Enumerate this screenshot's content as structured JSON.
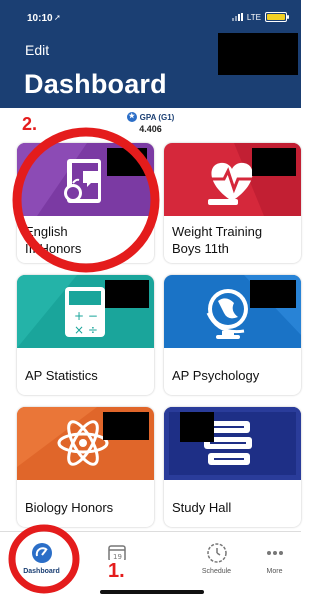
{
  "status_bar": {
    "time": "10:10",
    "carrier": "LTE"
  },
  "header": {
    "edit_label": "Edit",
    "title": "Dashboard"
  },
  "gpa": {
    "label": "GPA (G1)",
    "value": "4.406"
  },
  "annotations": {
    "step1": "1.",
    "step2": "2."
  },
  "cards": [
    {
      "label_line1": "English",
      "label_line2": "III Honors",
      "color": "#7b3aa3"
    },
    {
      "label_line1": "Weight Training",
      "label_line2": "Boys 11th",
      "color": "#d5283b"
    },
    {
      "label_line1": "AP Statistics",
      "label_line2": "",
      "color": "#1aa59b"
    },
    {
      "label_line1": "AP Psychology",
      "label_line2": "",
      "color": "#1a73c6"
    },
    {
      "label_line1": "Biology Honors",
      "label_line2": "",
      "color": "#e0662a"
    },
    {
      "label_line1": "Study Hall",
      "label_line2": "",
      "color": "#1e2f86"
    }
  ],
  "tabs": [
    {
      "label": "Dashboard",
      "icon": "dashboard-icon"
    },
    {
      "label": "Calendar",
      "icon": "calendar-icon"
    },
    {
      "label": "Schedule",
      "icon": "schedule-icon"
    },
    {
      "label": "More",
      "icon": "more-icon"
    }
  ],
  "colors": {
    "header": "#1b3f73",
    "annotation_red": "#e41c1c"
  }
}
